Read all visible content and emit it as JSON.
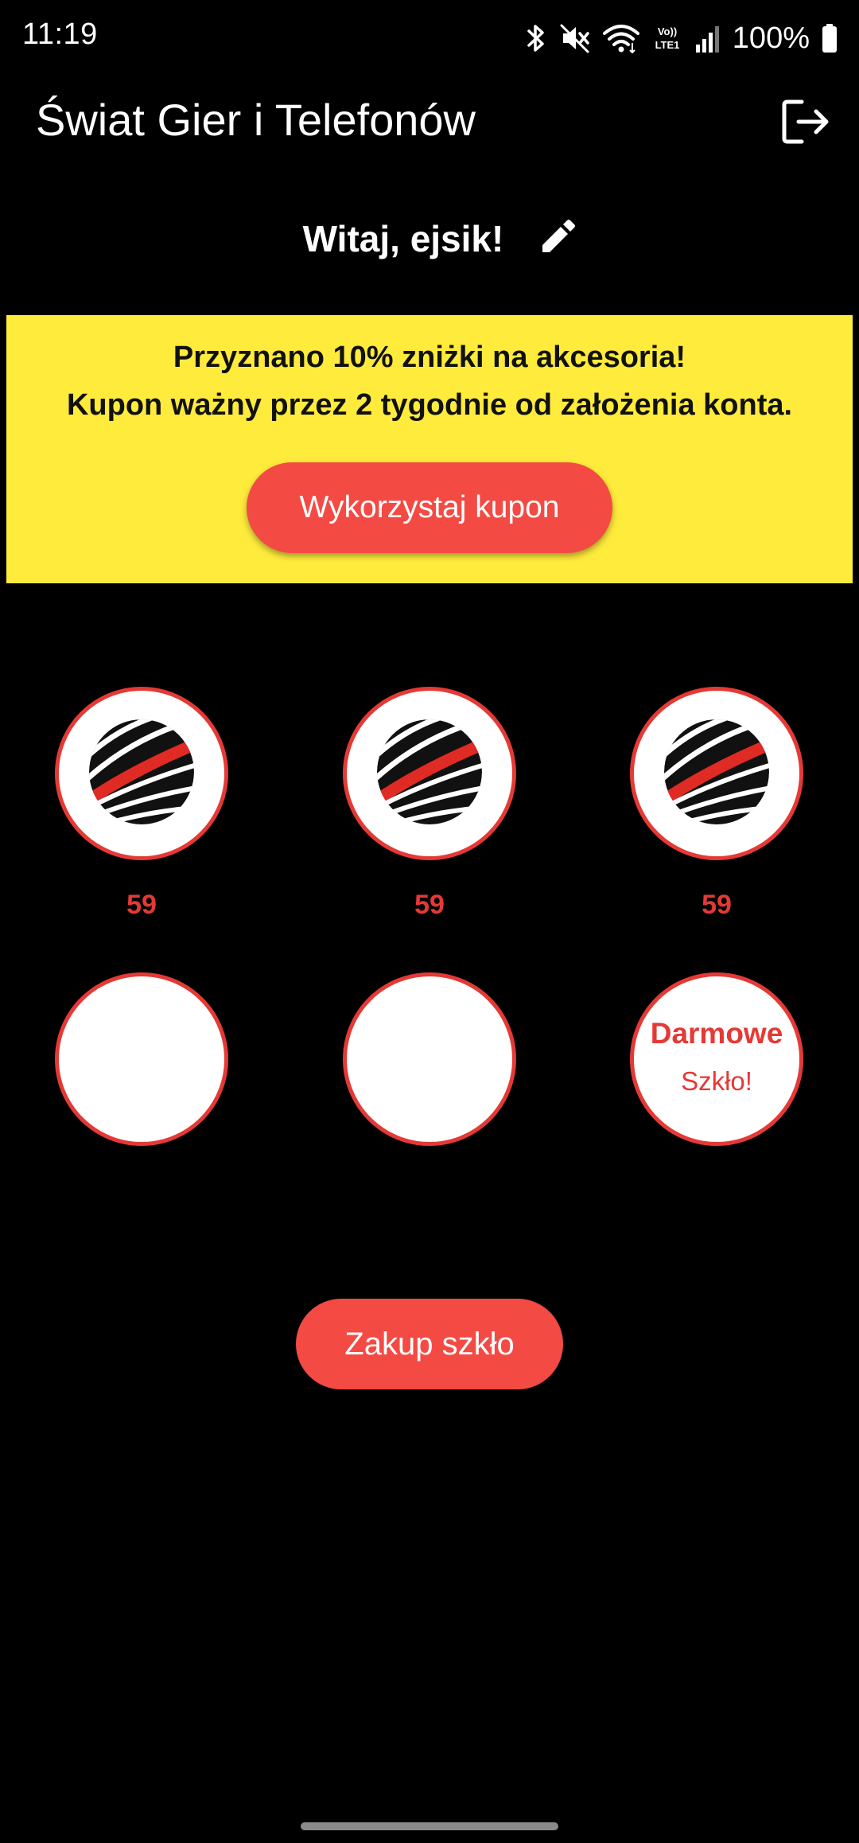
{
  "status_bar": {
    "time": "11:19",
    "battery_percent": "100%",
    "network_label": "Vo) LTE1",
    "icons": [
      "bluetooth-icon",
      "mute-icon",
      "wifi-icon",
      "volte-icon",
      "signal-icon",
      "battery-icon"
    ]
  },
  "app_bar": {
    "title": "Świat Gier i Telefonów",
    "logout_icon": "logout-icon"
  },
  "greeting": {
    "text": "Witaj, ejsik!",
    "edit_icon": "pencil-icon"
  },
  "coupon": {
    "line1": "Przyznano 10% zniżki na akcesoria!",
    "line2": "Kupon ważny przez 2 tygodnie od założenia konta.",
    "button_label": "Wykorzystaj kupon",
    "background_color": "#ffeb3b",
    "button_color": "#f44a44"
  },
  "stamps": {
    "items": [
      {
        "filled": true,
        "count": "59",
        "icon": "brand-logo-stamp"
      },
      {
        "filled": true,
        "count": "59",
        "icon": "brand-logo-stamp"
      },
      {
        "filled": true,
        "count": "59",
        "icon": "brand-logo-stamp"
      },
      {
        "filled": false
      },
      {
        "filled": false
      },
      {
        "filled": false,
        "reward_title": "Darmowe",
        "reward_subtitle": "Szkło!"
      }
    ],
    "accent_color": "#e53935"
  },
  "purchase": {
    "button_label": "Zakup szkło"
  }
}
